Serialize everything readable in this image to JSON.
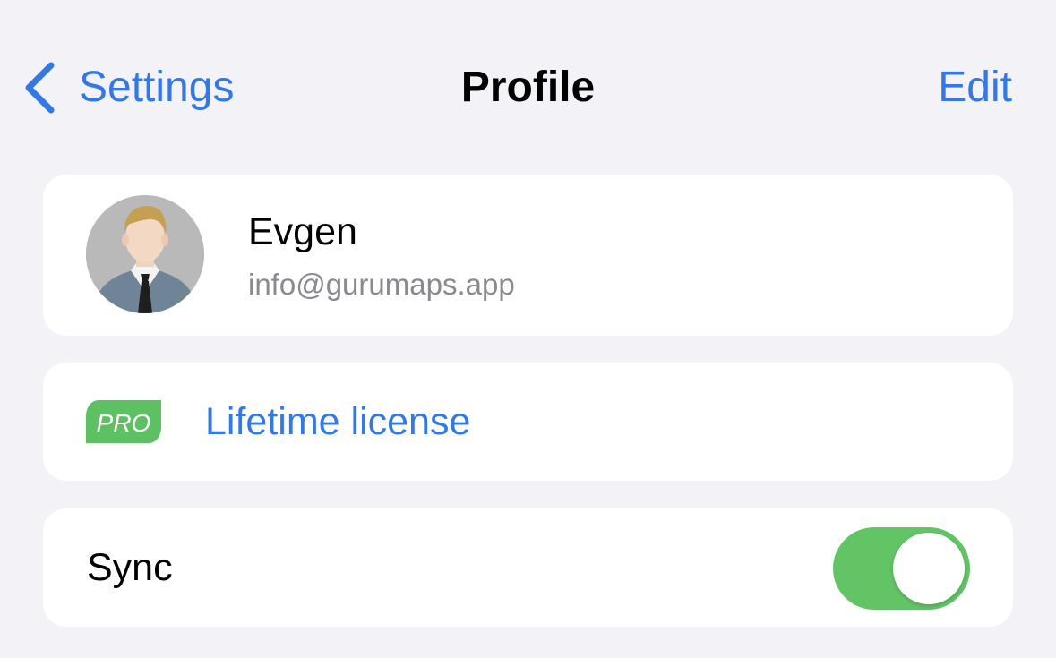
{
  "nav": {
    "back_label": "Settings",
    "title": "Profile",
    "edit_label": "Edit"
  },
  "profile": {
    "name": "Evgen",
    "email": "info@gurumaps.app",
    "avatar_icon": "user-avatar-icon"
  },
  "license": {
    "badge": "PRO",
    "label": "Lifetime license",
    "badge_color": "#5dc163"
  },
  "sync": {
    "label": "Sync",
    "enabled": true
  },
  "colors": {
    "background": "#f2f2f7",
    "accent": "#3478e5",
    "toggle_on": "#63c466",
    "secondary_text": "#8a8a8e"
  }
}
